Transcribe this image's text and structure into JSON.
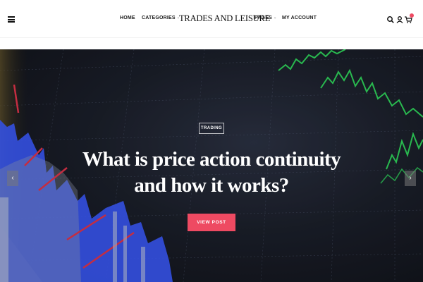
{
  "header": {
    "brand": "TRADES AND LEISURE",
    "nav": {
      "home": "HOME",
      "categories": "CATEGORIES",
      "pages": "PAGES",
      "account": "MY ACCOUNT"
    },
    "icons": [
      "hamburger-menu-icon",
      "search-icon",
      "user-icon",
      "cart-icon",
      "chevron-down-icon"
    ]
  },
  "hero": {
    "tag": "TRADING",
    "headline_line1": "What is price action continuity",
    "headline_line2": "and how it works?",
    "button_label": "VIEW POST",
    "prev_arrow": "‹",
    "next_arrow": "›"
  },
  "colors": {
    "accent": "#ee4a62",
    "hero_bg": "#1b1f2a",
    "chart_green": "#2fd35b",
    "chart_blue": "#3b5bff",
    "chart_red": "#e0344a"
  }
}
